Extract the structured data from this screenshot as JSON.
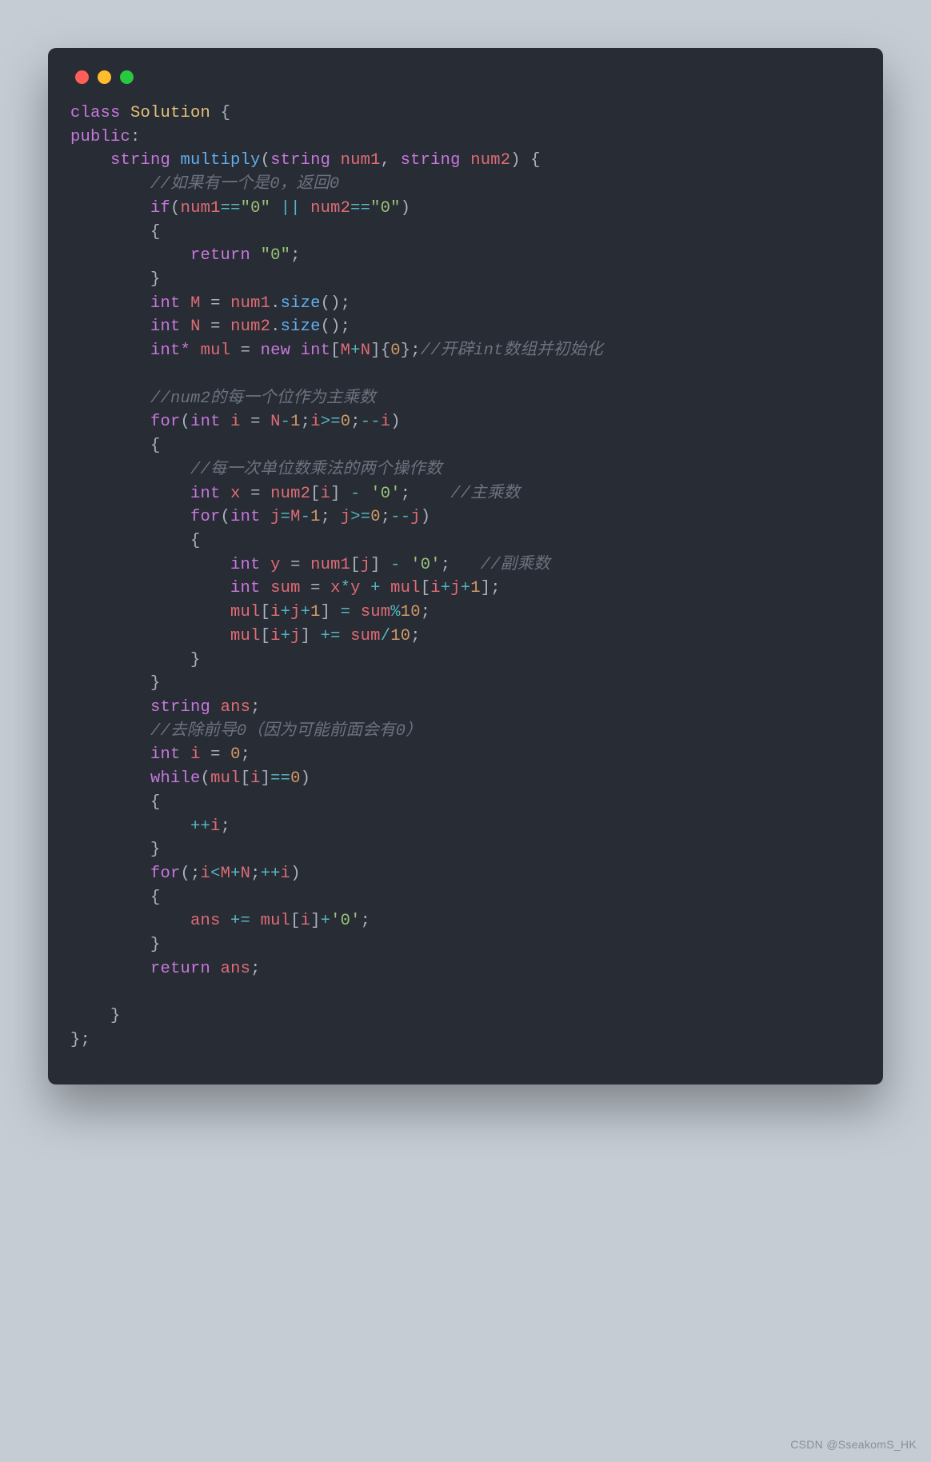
{
  "window": {
    "dots": [
      "red",
      "yellow",
      "green"
    ]
  },
  "code": {
    "l1": {
      "kw": "class",
      "name": "Solution",
      "brace": " {"
    },
    "l2": {
      "kw": "public",
      "colon": ":"
    },
    "l3": {
      "indent": "    ",
      "type": "string",
      "func": "multiply",
      "paren": "(",
      "t1": "string",
      "p1": "num1",
      "comma": ", ",
      "t2": "string",
      "p2": "num2",
      "close": ") {"
    },
    "l4": {
      "indent": "        ",
      "comment": "//如果有一个是0，返回0"
    },
    "l5": {
      "indent": "        ",
      "kw": "if",
      "open": "(",
      "v1": "num1",
      "op1": "==",
      "s1": "\"0\"",
      "or": " || ",
      "v2": "num2",
      "op2": "==",
      "s2": "\"0\"",
      "close": ")"
    },
    "l6": {
      "indent": "        ",
      "brace": "{"
    },
    "l7": {
      "indent": "            ",
      "kw": "return",
      "sp": " ",
      "s": "\"0\"",
      "semi": ";"
    },
    "l8": {
      "indent": "        ",
      "brace": "}"
    },
    "l9": {
      "indent": "        ",
      "type": "int",
      "v": "M",
      "eq": " = ",
      "v2": "num1",
      "dot": ".",
      "fn": "size",
      "call": "();"
    },
    "l10": {
      "indent": "        ",
      "type": "int",
      "v": "N",
      "eq": " = ",
      "v2": "num2",
      "dot": ".",
      "fn": "size",
      "call": "();"
    },
    "l11": {
      "indent": "        ",
      "type": "int*",
      "v": "mul",
      "eq": " = ",
      "kw": "new",
      "sp": " ",
      "t2": "int",
      "open": "[",
      "a": "M",
      "plus": "+",
      "b": "N",
      "close": "]{",
      "z": "0",
      "end": "};",
      "comment": "//开辟int数组并初始化"
    },
    "l12": {
      "indent": ""
    },
    "l13": {
      "indent": "        ",
      "comment": "//num2的每一个位作为主乘数"
    },
    "l14": {
      "indent": "        ",
      "kw": "for",
      "open": "(",
      "t": "int",
      "v": "i",
      "eq": " = ",
      "v2": "N",
      "m": "-",
      "one": "1",
      "semi": ";",
      "v3": "i",
      "ge": ">=",
      "z": "0",
      "semi2": ";",
      "dec": "--",
      "v4": "i",
      "close": ")"
    },
    "l15": {
      "indent": "        ",
      "brace": "{"
    },
    "l16": {
      "indent": "            ",
      "comment": "//每一次单位数乘法的两个操作数"
    },
    "l17": {
      "indent": "            ",
      "t": "int",
      "v": "x",
      "eq": " = ",
      "v2": "num2",
      "open": "[",
      "i": "i",
      "close": "] ",
      "m": "-",
      "sp": " ",
      "ch": "'0'",
      "semi": ";",
      "pad": "    ",
      "comment": "//主乘数"
    },
    "l18": {
      "indent": "            ",
      "kw": "for",
      "open": "(",
      "t": "int",
      "v": "j",
      "eq": "=",
      "v2": "M",
      "m": "-",
      "one": "1",
      "semi": "; ",
      "v3": "j",
      "ge": ">=",
      "z": "0",
      "semi2": ";",
      "dec": "--",
      "v4": "j",
      "close": ")"
    },
    "l19": {
      "indent": "            ",
      "brace": "{"
    },
    "l20": {
      "indent": "                ",
      "t": "int",
      "v": "y",
      "eq": " = ",
      "v2": "num1",
      "open": "[",
      "j": "j",
      "close": "] ",
      "m": "-",
      "sp": " ",
      "ch": "'0'",
      "semi": ";",
      "pad": "   ",
      "comment": "//副乘数"
    },
    "l21": {
      "indent": "                ",
      "t": "int",
      "v": "sum",
      "eq": " = ",
      "x": "x",
      "mul": "*",
      "y": "y",
      "plus": " + ",
      "arr": "mul",
      "open": "[",
      "i": "i",
      "p1": "+",
      "j": "j",
      "p2": "+",
      "one": "1",
      "close": "];"
    },
    "l22": {
      "indent": "                ",
      "arr": "mul",
      "open": "[",
      "i": "i",
      "p1": "+",
      "j": "j",
      "p2": "+",
      "one": "1",
      "close": "] ",
      "eq": "=",
      "sp": " ",
      "v": "sum",
      "mod": "%",
      "ten": "10",
      "semi": ";"
    },
    "l23": {
      "indent": "                ",
      "arr": "mul",
      "open": "[",
      "i": "i",
      "p1": "+",
      "j": "j",
      "close": "] ",
      "pe": "+=",
      "sp": " ",
      "v": "sum",
      "div": "/",
      "ten": "10",
      "semi": ";"
    },
    "l24": {
      "indent": "            ",
      "brace": "}"
    },
    "l25": {
      "indent": "        ",
      "brace": "}"
    },
    "l26": {
      "indent": "        ",
      "t": "string",
      "v": "ans",
      "semi": ";"
    },
    "l27": {
      "indent": "        ",
      "comment": "//去除前导0（因为可能前面会有0）"
    },
    "l28": {
      "indent": "        ",
      "t": "int",
      "v": "i",
      "eq": " = ",
      "z": "0",
      "semi": ";"
    },
    "l29": {
      "indent": "        ",
      "kw": "while",
      "open": "(",
      "arr": "mul",
      "b1": "[",
      "i": "i",
      "b2": "]",
      "eqeq": "==",
      "z": "0",
      "close": ")"
    },
    "l30": {
      "indent": "        ",
      "brace": "{"
    },
    "l31": {
      "indent": "            ",
      "inc": "++",
      "v": "i",
      "semi": ";"
    },
    "l32": {
      "indent": "        ",
      "brace": "}"
    },
    "l33": {
      "indent": "        ",
      "kw": "for",
      "open": "(;",
      "v": "i",
      "lt": "<",
      "a": "M",
      "plus": "+",
      "b": "N",
      "semi": ";",
      "inc": "++",
      "v2": "i",
      "close": ")"
    },
    "l34": {
      "indent": "        ",
      "brace": "{"
    },
    "l35": {
      "indent": "            ",
      "v": "ans",
      "pe": " += ",
      "arr": "mul",
      "b1": "[",
      "i": "i",
      "b2": "]",
      "plus": "+",
      "ch": "'0'",
      "semi": ";"
    },
    "l36": {
      "indent": "        ",
      "brace": "}"
    },
    "l37": {
      "indent": "        ",
      "kw": "return",
      "sp": " ",
      "v": "ans",
      "semi": ";"
    },
    "l38": {
      "indent": ""
    },
    "l39": {
      "indent": "    ",
      "brace": "}"
    },
    "l40": {
      "close": "};"
    }
  },
  "watermark": "CSDN @SseakomS_HK"
}
